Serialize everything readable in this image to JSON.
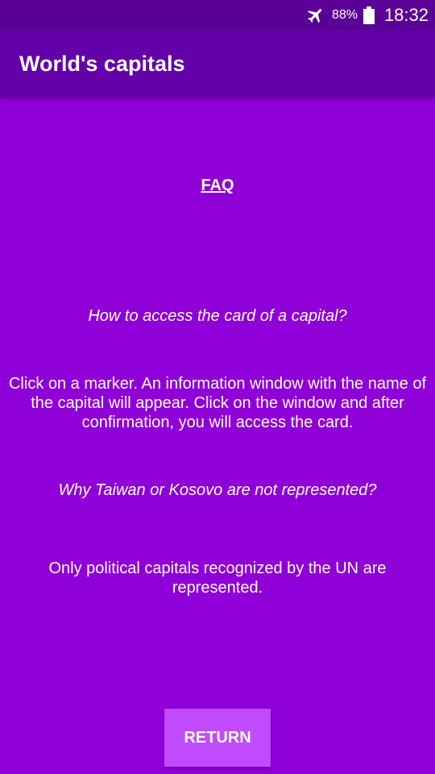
{
  "status_bar": {
    "airplane_icon": "airplane-icon",
    "battery_percent": "88%",
    "battery_icon": "battery-icon",
    "time": "18:32"
  },
  "app_bar": {
    "title": "World's capitals"
  },
  "faq": {
    "heading": "FAQ",
    "items": [
      {
        "question": "How to access the card of a capital?",
        "answer": "Click on a marker. An information window with the name of the capital will appear. Click on the window and after confirmation, you will access the card."
      },
      {
        "question": "Why Taiwan or Kosovo are not represented?",
        "answer": "Only political capitals recognized by the UN are represented."
      }
    ]
  },
  "return_button": {
    "label": "RETURN"
  },
  "colors": {
    "status_bar": "#5a0097",
    "app_bar": "#6400aa",
    "background": "#8f00d8",
    "button": "#c14bff",
    "text": "#ffffff"
  }
}
